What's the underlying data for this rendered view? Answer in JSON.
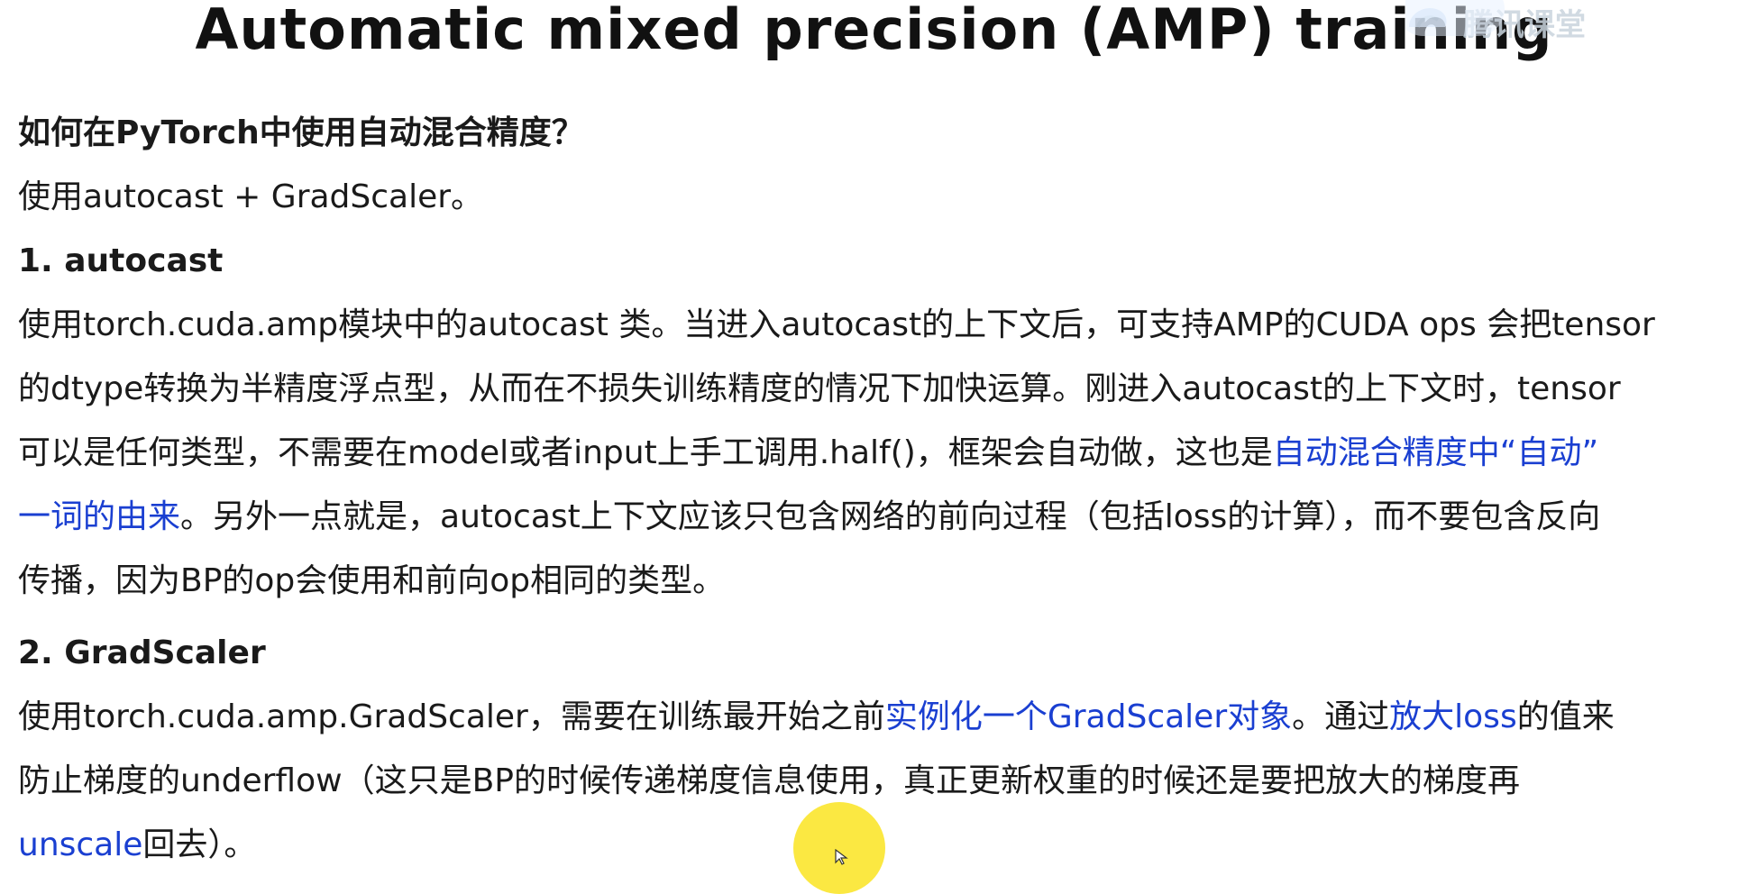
{
  "title": "Automatic mixed precision (AMP) training",
  "watermark": {
    "text": "腾讯课堂"
  },
  "content": {
    "q_heading": "如何在PyTorch中使用自动混合精度？",
    "q_answer": "使用autocast + GradScaler。",
    "s1": {
      "heading": "1. autocast",
      "l1": "使用torch.cuda.amp模块中的autocast 类。当进入autocast的上下文后，可支持AMP的CUDA ops 会把tensor",
      "l2": "的dtype转换为半精度浮点型，从而在不损失训练精度的情况下加快运算。刚进入autocast的上下文时，tensor",
      "l3_a": "可以是任何类型，不需要在model或者input上手工调用.half()，框架会自动做，这也是",
      "l3_link": "自动混合精度中“自动”",
      "l4_link": "一词的由来",
      "l4_b": "。另外一点就是，autocast上下文应该只包含网络的前向过程（包括loss的计算），而不要包含反向",
      "l5": "传播，因为BP的op会使用和前向op相同的类型。"
    },
    "s2": {
      "heading": "2. GradScaler",
      "l1_a": "使用torch.cuda.amp.GradScaler，需要在训练最开始之前",
      "l1_link": "实例化一个GradScaler对象",
      "l1_b": "。通过",
      "l1_link2": "放大loss",
      "l1_c": "的值来",
      "l2": "防止梯度的underflow（这只是BP的时候传递梯度信息使用，真正更新权重的时候还是要把放大的梯度再",
      "l3_link": "unscale",
      "l3_b": "回去）。"
    }
  },
  "colors": {
    "text": "#1a1a1a",
    "link": "#1a3fd1",
    "cursor_highlight": "#fbe62e"
  }
}
